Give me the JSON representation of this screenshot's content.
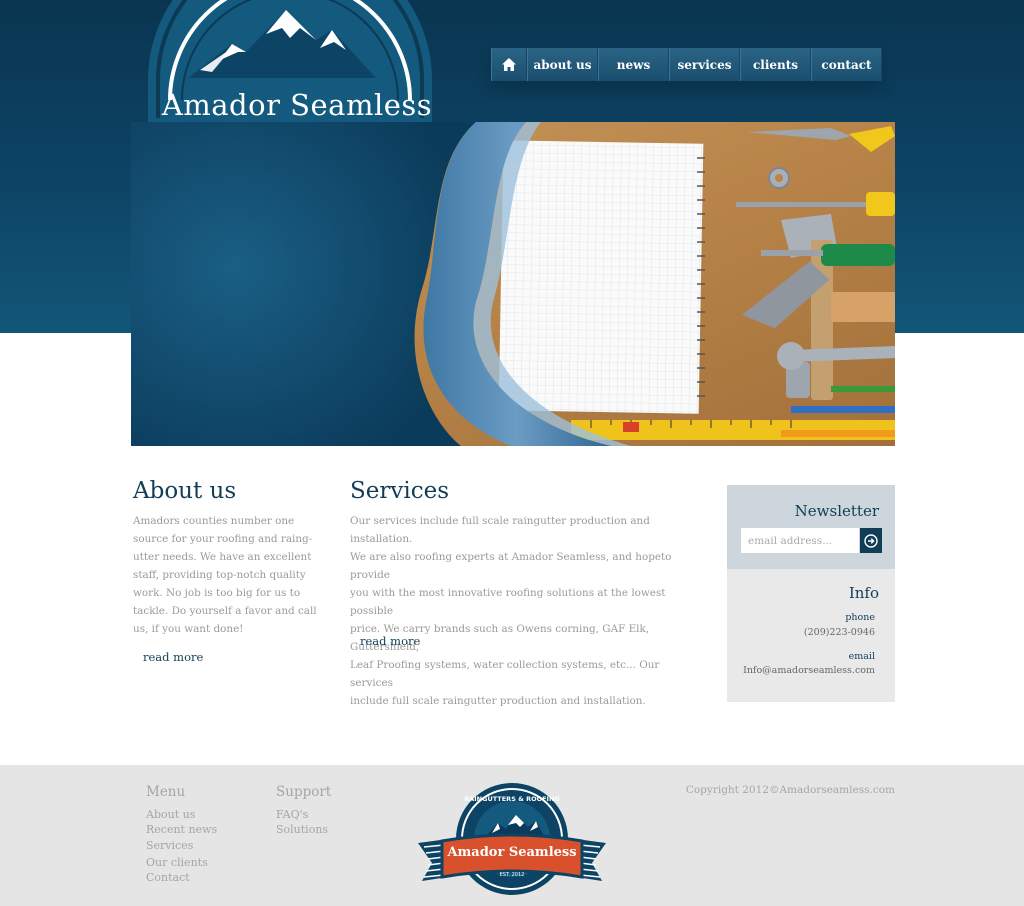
{
  "brand": {
    "name": "Amador Seamless"
  },
  "nav": {
    "items": [
      {
        "label": "about us"
      },
      {
        "label": "news"
      },
      {
        "label": "services"
      },
      {
        "label": "clients"
      },
      {
        "label": "contact"
      }
    ]
  },
  "about": {
    "title": "About us",
    "lines": [
      "Amadors counties number one",
      "source for your roofing and raing-",
      "utter needs. We have an excellent",
      "staff, providing top-notch quality",
      "work. No job is too big for us to",
      "tackle. Do yourself a favor and call",
      "us, if you want done!"
    ],
    "read_more": "read more"
  },
  "services": {
    "title": "Services",
    "lines": [
      "Our services include full scale raingutter production and installation.",
      "We are also roofing experts at Amador Seamless, and hopeto provide",
      "you with the most innovative roofing solutions at the lowest possible",
      "price. We carry brands such as Owens corning, GAF Elk, Guttershield,",
      "Leaf Proofing systems, water collection systems,  etc... Our services",
      "include full scale raingutter production and installation."
    ],
    "read_more": "read more"
  },
  "newsletter": {
    "title": "Newsletter",
    "placeholder": "email address..."
  },
  "info": {
    "title": "Info",
    "phone_label": "phone",
    "phone": "(209)223-0946",
    "email_label": "email",
    "email": "Info@amadorseamless.com"
  },
  "footer": {
    "menu_heading": "Menu",
    "menu_links": [
      "About us",
      "Recent news",
      "Services",
      "Our clients",
      "Contact"
    ],
    "support_heading": "Support",
    "support_links": [
      "FAQ's",
      "Solutions"
    ],
    "copyright": "Copyright 2012©Amadorseamless.com",
    "badge": {
      "name": "Amador Seamless",
      "arc_text": "RAINGUTTERS & ROOFING",
      "est": "EST. 2012"
    }
  },
  "colors": {
    "navy": "#123d57",
    "band": "#0d4466",
    "badge_red": "#d9512c",
    "text_gray": "#9a9a9a"
  },
  "icons": {
    "home": "home-icon",
    "submit": "arrow-right-circle-icon"
  }
}
